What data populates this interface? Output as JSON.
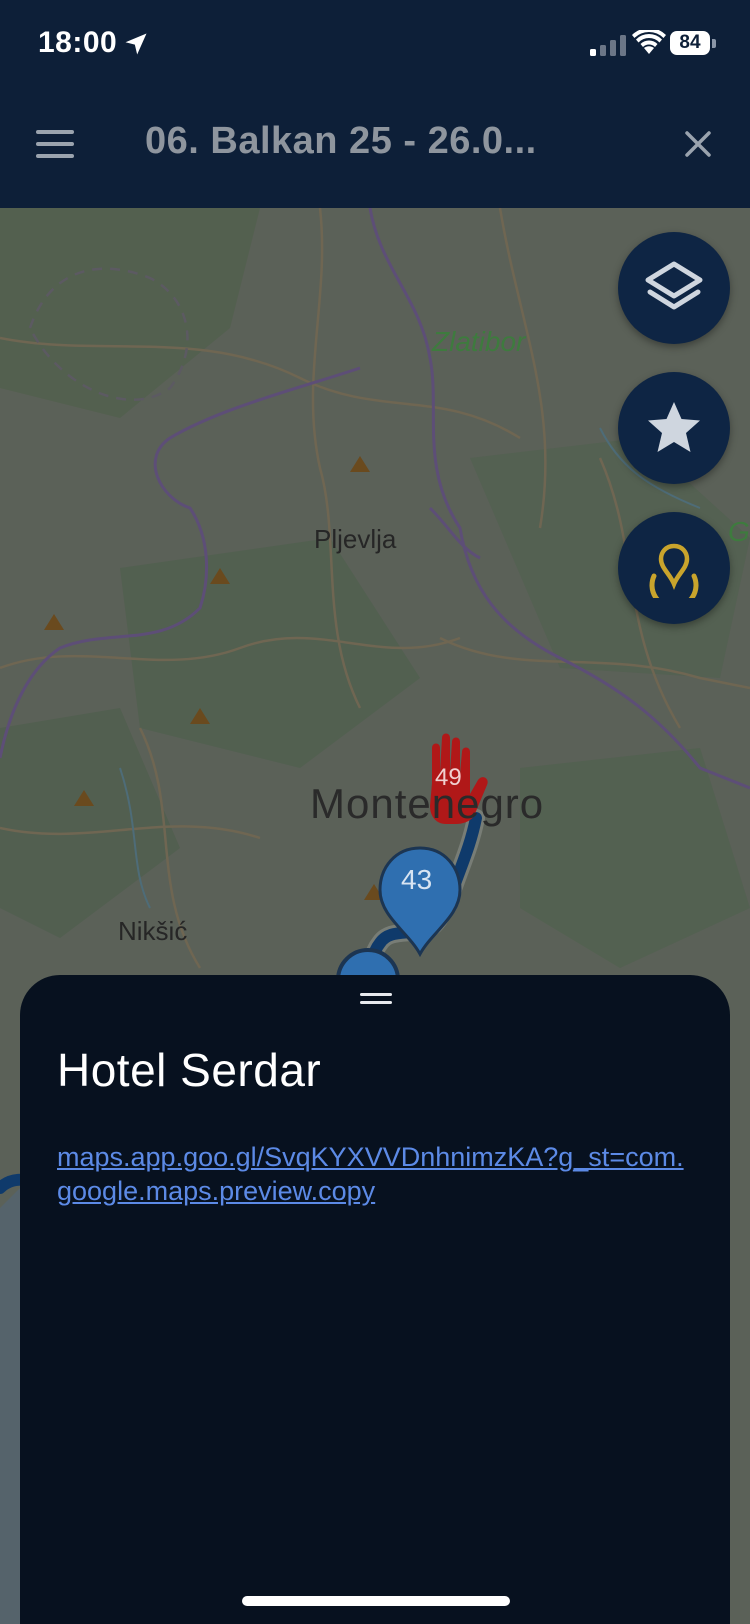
{
  "status_bar": {
    "time": "18:00",
    "battery": "84"
  },
  "header": {
    "title": "06. Balkan 25 -  26.0...",
    "menu_icon": "hamburger-icon",
    "close_icon": "close-icon"
  },
  "map": {
    "labels": {
      "zlatibor": "Zlatibor",
      "pljevlja": "Pljevlja",
      "montenegro": "Montenegro",
      "niksic": "Nikšić",
      "edge": "G"
    },
    "markers": {
      "stop_marker": "49",
      "waypoint": "43"
    },
    "colors": {
      "route": "#0f3a6b",
      "marker_blue": "#2f6fb0",
      "marker_red": "#b01818"
    }
  },
  "fabs": [
    {
      "name": "layers-button",
      "icon": "layers-icon"
    },
    {
      "name": "favorites-button",
      "icon": "star-icon"
    },
    {
      "name": "locate-button",
      "icon": "location-target-icon",
      "accent": "#c9a42c"
    }
  ],
  "sheet": {
    "title": "Hotel Serdar",
    "link": "maps.app.goo.gl/SvqKYXVVDnhnimzKA?g_st=com.google.maps.preview.copy"
  }
}
